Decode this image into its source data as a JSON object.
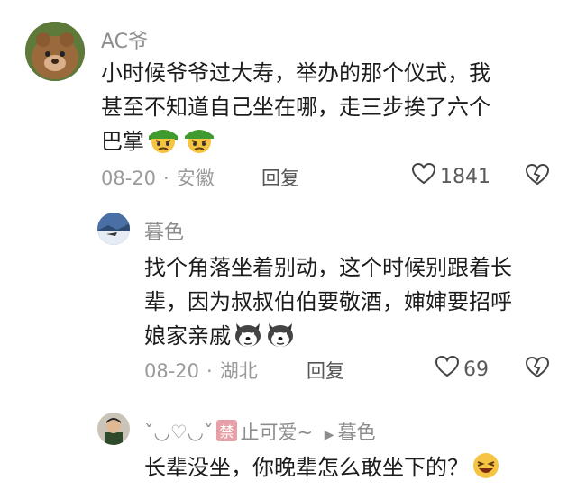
{
  "comments": [
    {
      "username": "AC爷",
      "lines": [
        "小时候爷爷过大寿，举办的那个仪式，我",
        "甚至不知道自己坐在哪，走三步挨了六个",
        "巴掌"
      ],
      "date": "08-20",
      "location": "安徽",
      "reply_label": "回复",
      "likes": "1841"
    },
    {
      "username": "暮色",
      "lines": [
        "找个角落坐着别动，这个时候别跟着长",
        "辈，因为叔叔伯伯要敬酒，婶婶要招呼",
        "娘家亲戚"
      ],
      "date": "08-20",
      "location": "湖北",
      "reply_label": "回复",
      "likes": "69"
    },
    {
      "username_prefix": "ˇ◡♡◡ˇ",
      "badge": "禁",
      "username": "止可爱~",
      "reply_to": "暮色",
      "lines": [
        "长辈没坐，你晚辈怎么敢坐下的？"
      ]
    }
  ],
  "colors": {
    "meta": "#9a9a9a",
    "text": "#1c1c1c",
    "username": "#8d8d8d"
  },
  "icons": [
    "heart-outline-icon",
    "heart-broken-icon",
    "angry-emoji-icon",
    "husky-emoji-icon",
    "laughing-emoji-icon",
    "reply-arrow-icon"
  ]
}
